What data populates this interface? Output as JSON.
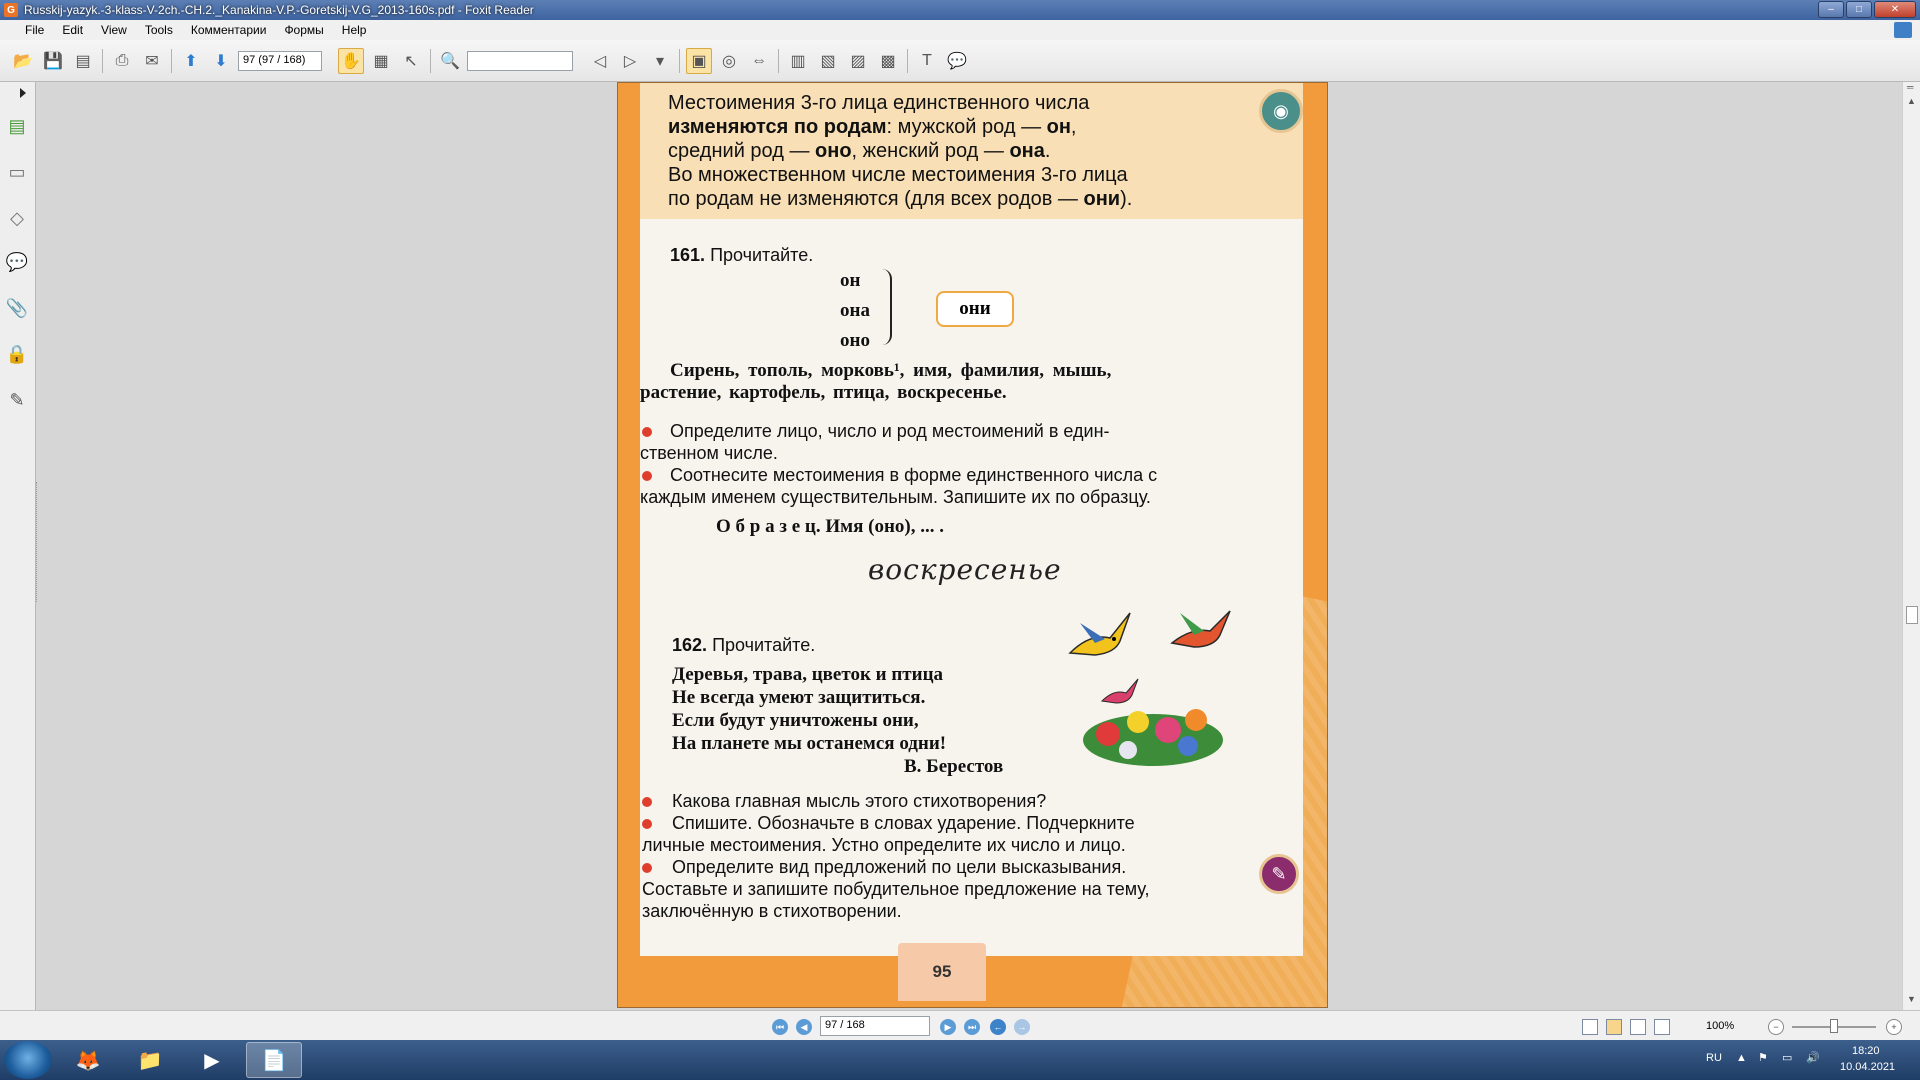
{
  "window": {
    "title": "Russkij-yazyk.-3-klass-V-2ch.-CH.2._Kanakina-V.P.-Goretskij-V.G_2013-160s.pdf - Foxit Reader",
    "minimize": "–",
    "maximize": "□",
    "close": "✕"
  },
  "menu": [
    "File",
    "Edit",
    "View",
    "Tools",
    "Комментарии",
    "Формы",
    "Help"
  ],
  "toolbar": {
    "page_field": "97 (97 / 168)",
    "search_placeholder": ""
  },
  "sidebar_icons": [
    "pages-icon",
    "bookmarks-icon",
    "eraser-icon",
    "comments-icon",
    "attachment-icon",
    "security-icon",
    "signature-icon"
  ],
  "page": {
    "rule_line1": "Местоимения 3-го лица единственного числа",
    "rule_line2_bold": "изменяются по родам",
    "rule_line2_rest": ": мужской род — ",
    "rule_on": "он",
    "rule_line3a": "средний род — ",
    "rule_ono": "оно",
    "rule_line3b": ", женский род — ",
    "rule_ona": "она",
    "rule_line4": "Во множественном числе местоимения 3-го лица",
    "rule_line5a": "по родам не изменяются (для всех родов — ",
    "rule_oni": "они",
    "rule_line5b": ").",
    "ex161_num": "161.",
    "ex161_task": "Прочитайте.",
    "pron_on": "он",
    "pron_ona": "она",
    "pron_ono": "оно",
    "pron_oni": "они",
    "words_line1": "Сирень, тополь, морковь¹, имя, фамилия, мышь,",
    "words_line2": "растение, картофель, птица, воскресенье.",
    "task161_1a": "Определите лицо, число и род местоимений в един-",
    "task161_1b": "ственном числе.",
    "task161_2a": "Соотнесите местоимения в форме единственного числа с",
    "task161_2b": "каждым именем существительным. Запишите их по образцу.",
    "sample": "О б р а з е ц.  Имя (оно), ... .",
    "script_word": "воскресенье",
    "ex162_num": "162.",
    "ex162_task": "Прочитайте.",
    "poem": [
      "Деревья, трава, цветок и птица",
      "Не всегда умеют защититься.",
      "Если будут уничтожены они,",
      "На планете мы останемся одни!"
    ],
    "poem_author": "В. Берестов",
    "task162_1": "Какова главная мысль этого стихотворения?",
    "task162_2a": "Спишите. Обозначьте в словах ударение. Подчеркните",
    "task162_2b": "личные местоимения. Устно определите их число и лицо.",
    "task162_3a": "Определите вид предложений по цели высказывания.",
    "task162_3b": "Составьте и запишите побудительное предложение на тему,",
    "task162_3c": "заключённую в стихотворении.",
    "page_number": "95"
  },
  "statusbar": {
    "page_field": "97 / 168",
    "zoom": "100%"
  },
  "taskbar": {
    "lang": "RU",
    "time": "18:20",
    "date": "10.04.2021",
    "apps": [
      "firefox-icon",
      "explorer-icon",
      "media-player-icon",
      "foxit-icon"
    ]
  },
  "colors": {
    "page_orange": "#f19b3c",
    "rule_box": "#f8dfb5",
    "bullet_red": "#e03e2d",
    "owl_teal": "#4a8f8a",
    "pen_purple": "#8b2c6c"
  }
}
